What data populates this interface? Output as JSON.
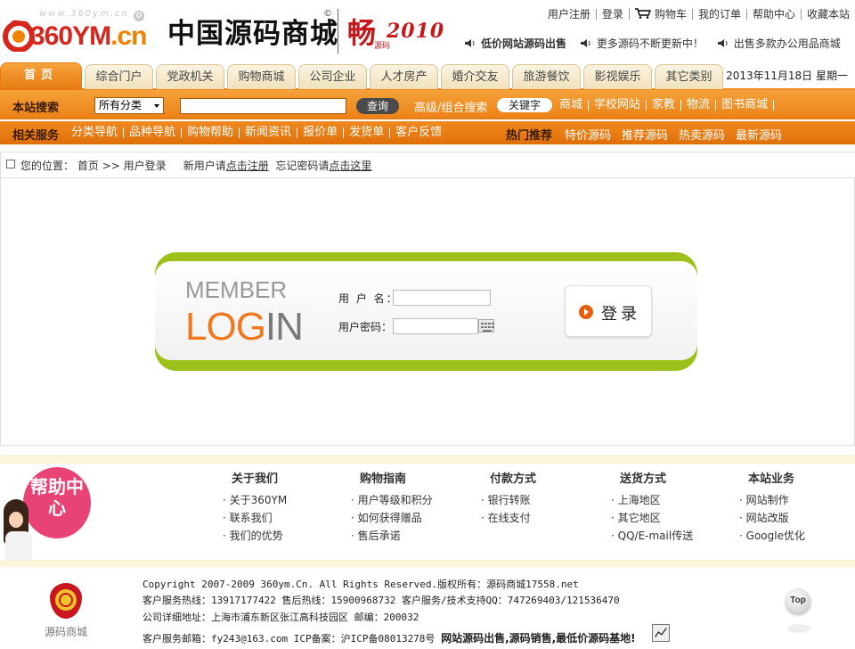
{
  "header": {
    "logo_url": "www.360ym.cn",
    "logo_brand": "360YM",
    "logo_brand_suffix": ".cn",
    "site_name": "中国源码商城",
    "reg_mark": "©",
    "promo_char": "畅",
    "promo_year": "2010",
    "promo_sub": "源码"
  },
  "topnav": {
    "items": [
      "用户注册",
      "登录",
      "购物车",
      "我的订单",
      "帮助中心",
      "收藏本站"
    ]
  },
  "notices": [
    "低价网站源码出售",
    "更多源码不断更新中！",
    "出售多款办公用品商城"
  ],
  "tabs": [
    "首页",
    "综合门户",
    "党政机关",
    "购物商城",
    "公司企业",
    "人才房产",
    "婚介交友",
    "旅游餐饮",
    "影视娱乐",
    "其它类别"
  ],
  "date": "2013年11月18日 星期一",
  "search": {
    "label": "本站搜索",
    "category": "所有分类",
    "button": "查询",
    "advanced": "高级/组合搜索",
    "keyword_label": "关键字",
    "keywords": [
      "商城",
      "学校网站",
      "家教",
      "物流",
      "图书商城"
    ]
  },
  "services": {
    "label": "相关服务",
    "links": [
      "分类导航",
      "品种导航",
      "购物帮助",
      "新闻资讯",
      "报价单",
      "发货单",
      "客户反馈"
    ],
    "hot_label": "热门推荐",
    "hot_links": [
      "特价源码",
      "推荐源码",
      "热卖源码",
      "最新源码"
    ]
  },
  "breadcrumb": {
    "prefix": "您的位置：",
    "home": "首页",
    "sep": ">>",
    "current": "用户登录",
    "reg_pre": "新用户请",
    "reg_link": "点击注册",
    "forgot_pre": "忘记密码请",
    "forgot_link": "点击这里"
  },
  "login": {
    "member": "MEMBER",
    "login_o": "LOG",
    "login_g": "IN",
    "user_label": "用 户 名：",
    "pass_label": "用户密码：",
    "user_value": "",
    "pass_value": "",
    "button": "登录"
  },
  "help_badge": "帮助中心",
  "footer_cols": [
    {
      "title": "关于我们",
      "items": [
        "关于360YM",
        "联系我们",
        "我们的优势"
      ]
    },
    {
      "title": "购物指南",
      "items": [
        "用户等级和积分",
        "如何获得赠品",
        "售后承诺"
      ]
    },
    {
      "title": "付款方式",
      "items": [
        "银行转账",
        "在线支付"
      ]
    },
    {
      "title": "送货方式",
      "items": [
        "上海地区",
        "其它地区",
        "QQ/E-mail传送"
      ]
    },
    {
      "title": "本站业务",
      "items": [
        "网站制作",
        "网站改版",
        "Google优化"
      ]
    }
  ],
  "copyright": {
    "emblem_caption": "源码商城",
    "line1": "Copyright 2007-2009 360ym.Cn. All Rights Reserved.版权所有：源码商城17558.net",
    "line2": "客户服务热线：13917177422 售后热线：15900968732 客户服务/技术支持QQ：747269403/121536470",
    "line3": "公司详细地址：上海市浦东新区张江高科技园区 邮编：200032",
    "line4": "客户服务邮箱：fy243@163.com ICP备案：沪ICP备08013278号",
    "line4_bold": "网站源码出售,源码销售,最低价源码基地!"
  },
  "top_button": "Top",
  "colors": {
    "accent_orange": "#f08a20",
    "brand_red": "#d7261d",
    "login_green": "#9dc11a"
  }
}
